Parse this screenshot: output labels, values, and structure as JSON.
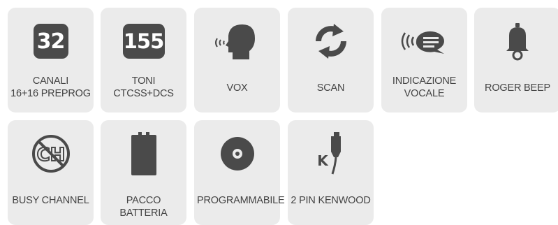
{
  "colors": {
    "tile_bg": "#ebebeb",
    "icon": "#4a4a4a",
    "text": "#444444"
  },
  "features": [
    {
      "icon": "number-badge-icon",
      "badge": "32",
      "label_lines": [
        "CANALI",
        "16+16 PREPROG"
      ]
    },
    {
      "icon": "number-badge-icon",
      "badge": "155",
      "label_lines": [
        "TONI",
        "CTCSS+DCS"
      ]
    },
    {
      "icon": "speaking-head-icon",
      "label_lines": [
        "VOX"
      ]
    },
    {
      "icon": "scan-arrows-icon",
      "label_lines": [
        "SCAN"
      ]
    },
    {
      "icon": "voice-bubble-icon",
      "label_lines": [
        "INDICAZIONE",
        "VOCALE"
      ]
    },
    {
      "icon": "bell-icon",
      "label_lines": [
        "ROGER BEEP"
      ]
    },
    {
      "icon": "busy-channel-icon",
      "badge": "CH",
      "label_lines": [
        "BUSY CHANNEL"
      ]
    },
    {
      "icon": "battery-icon",
      "label_lines": [
        "PACCO BATTERIA"
      ]
    },
    {
      "icon": "disc-icon",
      "label_lines": [
        "PROGRAMMABILE"
      ]
    },
    {
      "icon": "kenwood-plug-icon",
      "badge": "K",
      "label_lines": [
        "2 PIN KENWOOD"
      ]
    }
  ]
}
